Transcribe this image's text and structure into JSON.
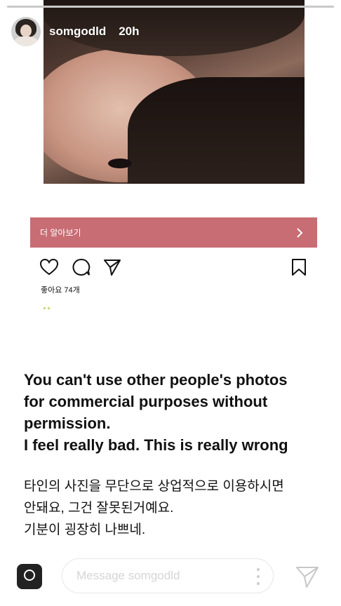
{
  "story": {
    "progress": 1.0,
    "username": "somgodld",
    "time": "20h"
  },
  "embedded_post": {
    "more_label": "더 알아보기",
    "likes": "좋아요 74개"
  },
  "caption": {
    "english": [
      "You can't use other people's photos",
      "for commercial purposes without",
      "permission.",
      "I feel really bad. This is really wrong"
    ],
    "korean": [
      "타인의 사진을 무단으로 상업적으로 이용하시면",
      "안돼요, 그건 잘못된거예요.",
      "기분이 굉장히 나쁘네."
    ]
  },
  "reply_bar": {
    "placeholder": "Message somgodld"
  },
  "colors": {
    "accent_bar": "#c76d73",
    "progress_bg": "#d9d9d9"
  }
}
